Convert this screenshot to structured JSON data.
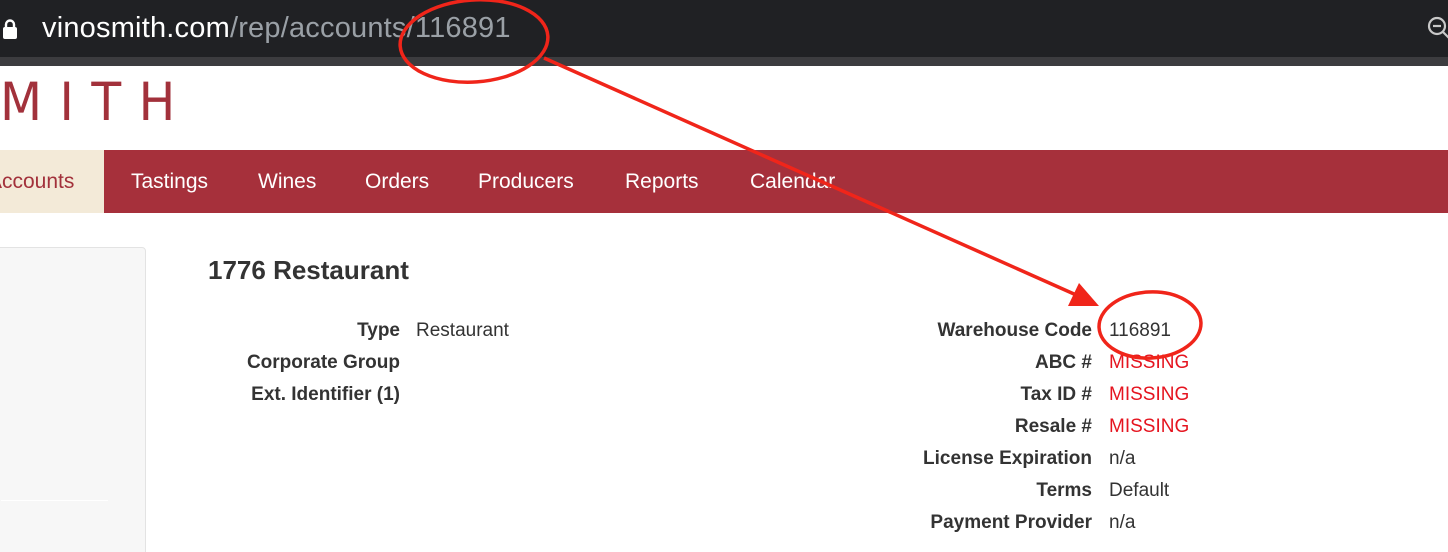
{
  "browser": {
    "url_host": "vinosmith.com",
    "url_path": "/rep/accounts/116891",
    "icons": {
      "lock": "lock-icon",
      "zoom": "zoom-out-icon"
    }
  },
  "site": {
    "logo_text": "MITH",
    "brand_color": "#a6303b",
    "nav": [
      {
        "label": "Accounts",
        "active": true
      },
      {
        "label": "Tastings"
      },
      {
        "label": "Wines"
      },
      {
        "label": "Orders"
      },
      {
        "label": "Producers"
      },
      {
        "label": "Reports"
      },
      {
        "label": "Calendar"
      }
    ]
  },
  "account": {
    "name": "1776 Restaurant",
    "left_fields": [
      {
        "label": "Type",
        "value": "Restaurant"
      },
      {
        "label": "Corporate Group",
        "value": ""
      },
      {
        "label": "Ext. Identifier (1)",
        "value": ""
      }
    ],
    "right_fields": [
      {
        "label": "Warehouse Code",
        "value": "116891"
      },
      {
        "label": "ABC #",
        "value": "MISSING",
        "missing": true
      },
      {
        "label": "Tax ID #",
        "value": "MISSING",
        "missing": true
      },
      {
        "label": "Resale #",
        "value": "MISSING",
        "missing": true
      },
      {
        "label": "License Expiration",
        "value": "n/a"
      },
      {
        "label": "Terms",
        "value": "Default"
      },
      {
        "label": "Payment Provider",
        "value": "n/a"
      }
    ],
    "missing_color": "#e5141f"
  },
  "annotation": {
    "color": "#f0251a"
  }
}
